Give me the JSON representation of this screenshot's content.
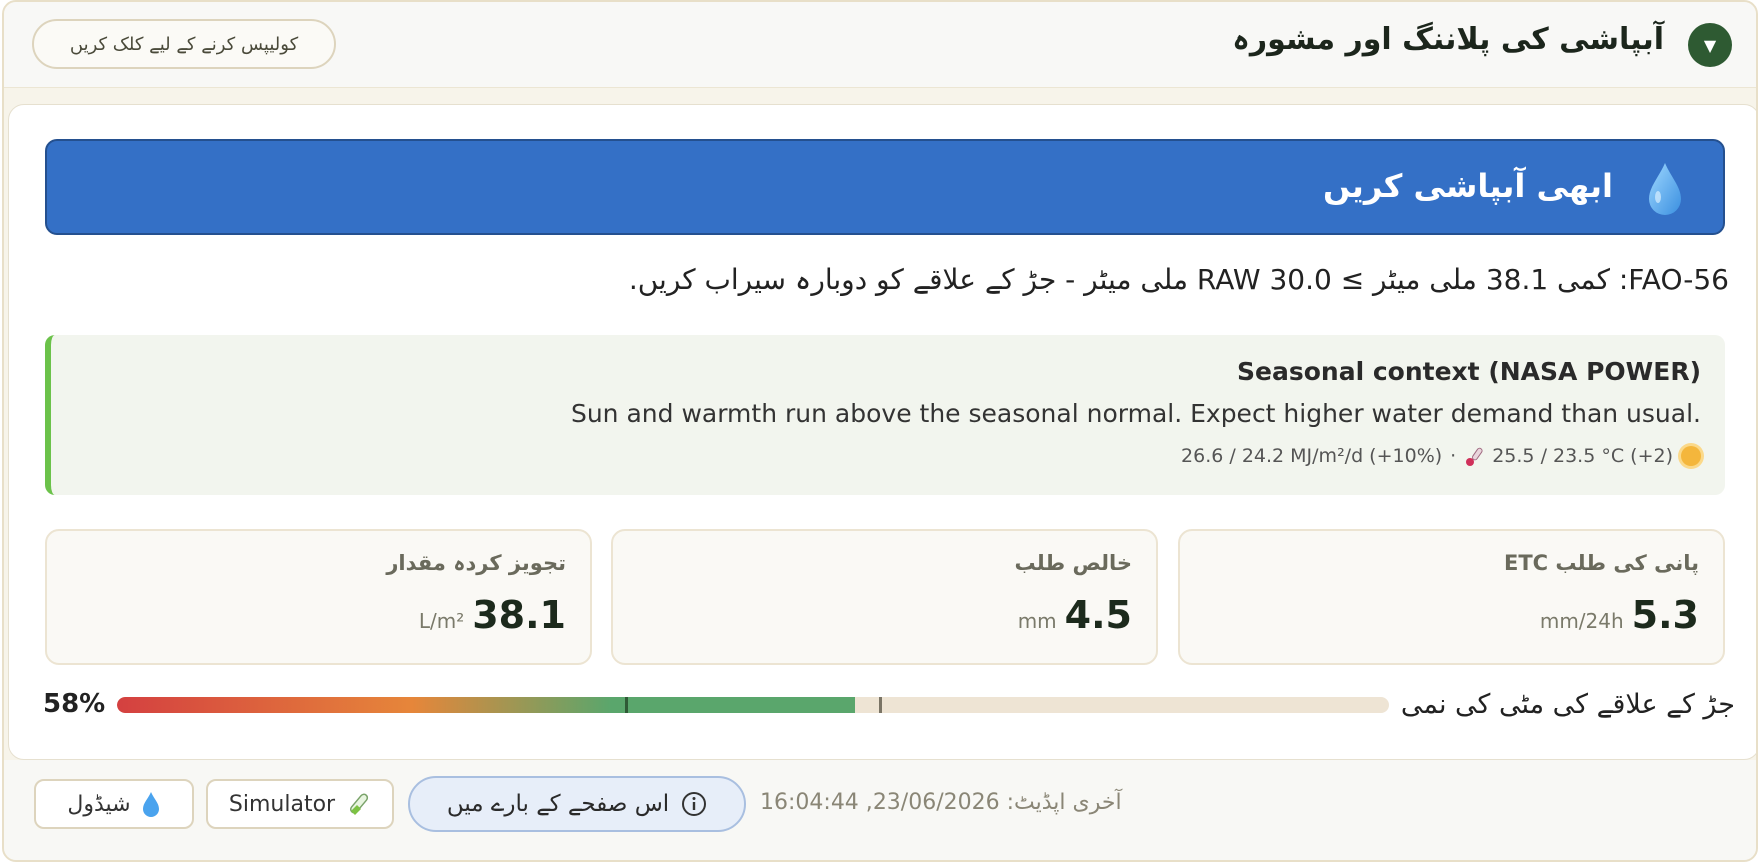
{
  "header": {
    "title": "آبپاشی کی پلاننگ اور مشورہ",
    "collapse_label": "کولیپس کرنے کے لیے کلک کریں",
    "toggle_icon": "chevron-down-icon",
    "toggle_glyph": "▼"
  },
  "banner": {
    "text": "ابھی آبپاشی کریں",
    "icon": "water-drop-icon",
    "color": "#3470c6"
  },
  "fao_line": "FAO-56: کمی 38.1 ملی میٹر ≥ RAW 30.0 ملی میٹر - جڑ کے علاقے کو دوبارہ سیراب کریں.",
  "seasonal": {
    "title": "Seasonal context (NASA POWER)",
    "text": "Sun and warmth run above the seasonal normal. Expect higher water demand than usual.",
    "solar": "26.6 / 24.2 MJ/m²/d (+10%)",
    "separator": "·",
    "temp": "25.5 / 23.5 °C (+2)",
    "accent": "#6bc24a"
  },
  "metrics": [
    {
      "label": "پانی کی طلب ETC",
      "value": "5.3",
      "unit": "mm/24h"
    },
    {
      "label": "خالص طلب",
      "value": "4.5",
      "unit": "mm"
    },
    {
      "label": "تجویز کردہ مقدار",
      "value": "38.1",
      "unit": "L/m²"
    }
  ],
  "moisture": {
    "label": "جڑ کے علاقے کی مٹی کی نمی",
    "percent_text": "58%",
    "fill_fraction": 0.58
  },
  "footer": {
    "last_update": "آخری اپڈیٹ: 23/06/2026, 16:04:44",
    "about_label": "اس صفحے کے بارے میں",
    "simulator_label": "Simulator",
    "schedule_label": "شیڈول"
  }
}
